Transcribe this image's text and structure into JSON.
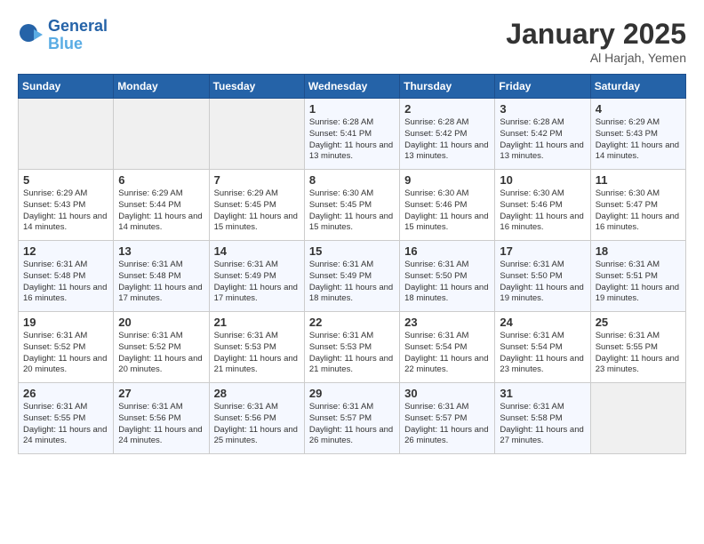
{
  "header": {
    "logo_line1": "General",
    "logo_line2": "Blue",
    "month": "January 2025",
    "location": "Al Harjah, Yemen"
  },
  "days_of_week": [
    "Sunday",
    "Monday",
    "Tuesday",
    "Wednesday",
    "Thursday",
    "Friday",
    "Saturday"
  ],
  "weeks": [
    [
      {
        "day": "",
        "content": ""
      },
      {
        "day": "",
        "content": ""
      },
      {
        "day": "",
        "content": ""
      },
      {
        "day": "1",
        "content": "Sunrise: 6:28 AM\nSunset: 5:41 PM\nDaylight: 11 hours\nand 13 minutes."
      },
      {
        "day": "2",
        "content": "Sunrise: 6:28 AM\nSunset: 5:42 PM\nDaylight: 11 hours\nand 13 minutes."
      },
      {
        "day": "3",
        "content": "Sunrise: 6:28 AM\nSunset: 5:42 PM\nDaylight: 11 hours\nand 13 minutes."
      },
      {
        "day": "4",
        "content": "Sunrise: 6:29 AM\nSunset: 5:43 PM\nDaylight: 11 hours\nand 14 minutes."
      }
    ],
    [
      {
        "day": "5",
        "content": "Sunrise: 6:29 AM\nSunset: 5:43 PM\nDaylight: 11 hours\nand 14 minutes."
      },
      {
        "day": "6",
        "content": "Sunrise: 6:29 AM\nSunset: 5:44 PM\nDaylight: 11 hours\nand 14 minutes."
      },
      {
        "day": "7",
        "content": "Sunrise: 6:29 AM\nSunset: 5:45 PM\nDaylight: 11 hours\nand 15 minutes."
      },
      {
        "day": "8",
        "content": "Sunrise: 6:30 AM\nSunset: 5:45 PM\nDaylight: 11 hours\nand 15 minutes."
      },
      {
        "day": "9",
        "content": "Sunrise: 6:30 AM\nSunset: 5:46 PM\nDaylight: 11 hours\nand 15 minutes."
      },
      {
        "day": "10",
        "content": "Sunrise: 6:30 AM\nSunset: 5:46 PM\nDaylight: 11 hours\nand 16 minutes."
      },
      {
        "day": "11",
        "content": "Sunrise: 6:30 AM\nSunset: 5:47 PM\nDaylight: 11 hours\nand 16 minutes."
      }
    ],
    [
      {
        "day": "12",
        "content": "Sunrise: 6:31 AM\nSunset: 5:48 PM\nDaylight: 11 hours\nand 16 minutes."
      },
      {
        "day": "13",
        "content": "Sunrise: 6:31 AM\nSunset: 5:48 PM\nDaylight: 11 hours\nand 17 minutes."
      },
      {
        "day": "14",
        "content": "Sunrise: 6:31 AM\nSunset: 5:49 PM\nDaylight: 11 hours\nand 17 minutes."
      },
      {
        "day": "15",
        "content": "Sunrise: 6:31 AM\nSunset: 5:49 PM\nDaylight: 11 hours\nand 18 minutes."
      },
      {
        "day": "16",
        "content": "Sunrise: 6:31 AM\nSunset: 5:50 PM\nDaylight: 11 hours\nand 18 minutes."
      },
      {
        "day": "17",
        "content": "Sunrise: 6:31 AM\nSunset: 5:50 PM\nDaylight: 11 hours\nand 19 minutes."
      },
      {
        "day": "18",
        "content": "Sunrise: 6:31 AM\nSunset: 5:51 PM\nDaylight: 11 hours\nand 19 minutes."
      }
    ],
    [
      {
        "day": "19",
        "content": "Sunrise: 6:31 AM\nSunset: 5:52 PM\nDaylight: 11 hours\nand 20 minutes."
      },
      {
        "day": "20",
        "content": "Sunrise: 6:31 AM\nSunset: 5:52 PM\nDaylight: 11 hours\nand 20 minutes."
      },
      {
        "day": "21",
        "content": "Sunrise: 6:31 AM\nSunset: 5:53 PM\nDaylight: 11 hours\nand 21 minutes."
      },
      {
        "day": "22",
        "content": "Sunrise: 6:31 AM\nSunset: 5:53 PM\nDaylight: 11 hours\nand 21 minutes."
      },
      {
        "day": "23",
        "content": "Sunrise: 6:31 AM\nSunset: 5:54 PM\nDaylight: 11 hours\nand 22 minutes."
      },
      {
        "day": "24",
        "content": "Sunrise: 6:31 AM\nSunset: 5:54 PM\nDaylight: 11 hours\nand 23 minutes."
      },
      {
        "day": "25",
        "content": "Sunrise: 6:31 AM\nSunset: 5:55 PM\nDaylight: 11 hours\nand 23 minutes."
      }
    ],
    [
      {
        "day": "26",
        "content": "Sunrise: 6:31 AM\nSunset: 5:55 PM\nDaylight: 11 hours\nand 24 minutes."
      },
      {
        "day": "27",
        "content": "Sunrise: 6:31 AM\nSunset: 5:56 PM\nDaylight: 11 hours\nand 24 minutes."
      },
      {
        "day": "28",
        "content": "Sunrise: 6:31 AM\nSunset: 5:56 PM\nDaylight: 11 hours\nand 25 minutes."
      },
      {
        "day": "29",
        "content": "Sunrise: 6:31 AM\nSunset: 5:57 PM\nDaylight: 11 hours\nand 26 minutes."
      },
      {
        "day": "30",
        "content": "Sunrise: 6:31 AM\nSunset: 5:57 PM\nDaylight: 11 hours\nand 26 minutes."
      },
      {
        "day": "31",
        "content": "Sunrise: 6:31 AM\nSunset: 5:58 PM\nDaylight: 11 hours\nand 27 minutes."
      },
      {
        "day": "",
        "content": ""
      }
    ]
  ]
}
